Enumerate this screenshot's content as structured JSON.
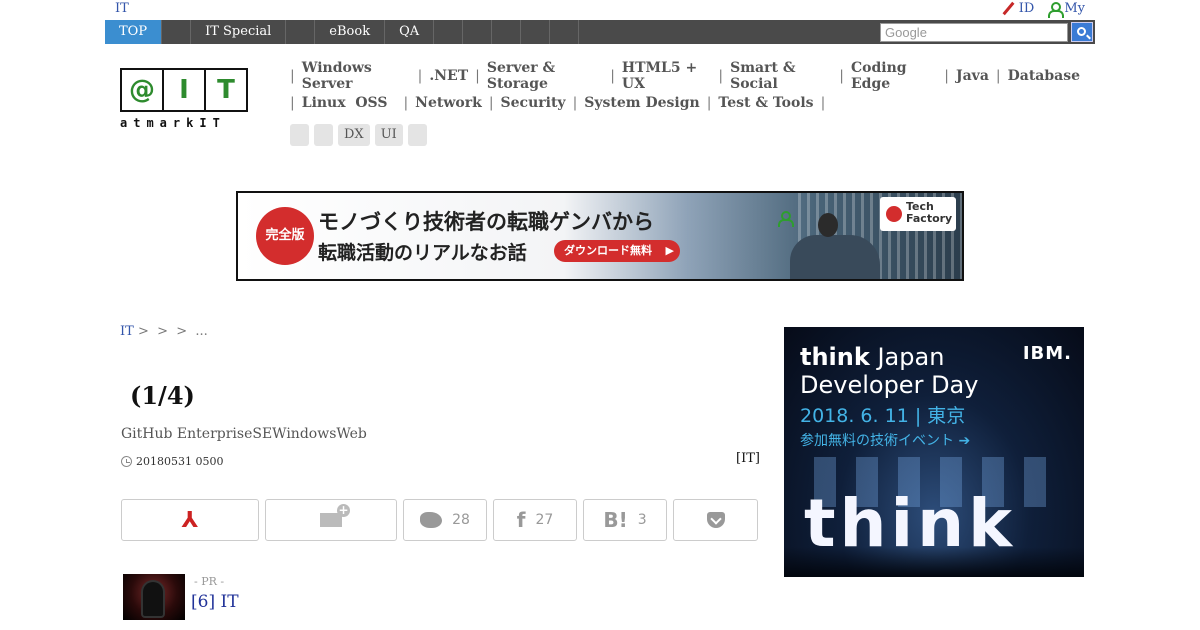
{
  "topbar": {
    "site_link": "IT",
    "id_label": "ID",
    "my_label": "My"
  },
  "nav": {
    "items": [
      "TOP",
      "",
      "IT Special",
      "",
      "eBook",
      "QA",
      "",
      "",
      "",
      "",
      ""
    ],
    "search_placeholder": "Google"
  },
  "logo": {
    "cells": [
      "@",
      "I",
      "T"
    ],
    "tagline": "atmarkIT"
  },
  "categories": {
    "row1": [
      "Windows Server",
      ".NET",
      "Server & Storage",
      "HTML5 + UX",
      "Smart & Social",
      "Coding Edge",
      "Java",
      "Database"
    ],
    "row2": [
      "Linux  OSS",
      "Network",
      "Security",
      "System Design",
      "Test & Tools"
    ],
    "chips": [
      "",
      "",
      "DX",
      "UI",
      ""
    ]
  },
  "banner": {
    "seal": "完全版",
    "line1": "モノづくり技術者の転職ゲンバから",
    "line2": "転職活動のリアルなお話",
    "cta": "ダウンロード無料",
    "brand": "Tech Factory"
  },
  "breadcrumb": {
    "home": "IT",
    "rest": " >  >  >  ..."
  },
  "article": {
    "title": "(1/4)",
    "subtitle": "GitHub EnterpriseSEWindowsWeb",
    "date": "20180531 0500",
    "source": "[IT]"
  },
  "share": {
    "pdf_icon": "pdf-icon",
    "twitter_count": "28",
    "facebook_count": "27",
    "hatena_count": "3"
  },
  "pr": {
    "label": "- PR -",
    "title": "[6] IT"
  },
  "ad": {
    "line1_bold": "think",
    "line1_rest": " Japan",
    "line2": "Developer Day",
    "line3": "2018. 6. 11 | 東京",
    "line4": "参加無料の技術イベント ➔",
    "brand": "IBM.",
    "big": "think"
  },
  "colors": {
    "nav_bg": "#4a4a4a",
    "nav_active": "#3b8ed0",
    "link": "#3355aa",
    "logo_green": "#2e8b2e",
    "banner_red": "#d32d2d",
    "ad_accent": "#43b3e6"
  }
}
